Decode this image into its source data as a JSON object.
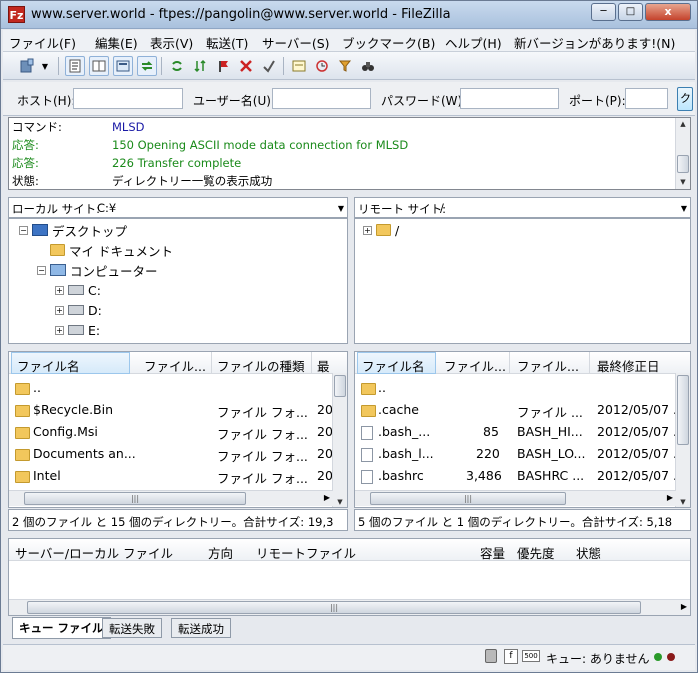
{
  "window": {
    "title": "www.server.world - ftpes://pangolin@www.server.world - FileZilla",
    "app_icon": "Fz",
    "minimize": "─",
    "maximize": "□",
    "close": "x"
  },
  "menu": [
    "ファイル(F)",
    "編集(E)",
    "表示(V)",
    "転送(T)",
    "サーバー(S)",
    "ブックマーク(B)",
    "ヘルプ(H)",
    "新バージョンがあります!(N)"
  ],
  "toolbar_icons": [
    "site-manager-icon",
    "dropdown-icon",
    "message-log-icon",
    "local-tree-icon",
    "remote-tree-icon",
    "transfer-queue-icon",
    "refresh-icon",
    "process-queue-icon",
    "cancel-icon",
    "disconnect-icon",
    "reconnect-icon",
    "directory-compare-icon",
    "sync-browsing-icon",
    "filter-icon",
    "find-icon",
    "binoculars-icon"
  ],
  "quickconnect": {
    "host_label": "ホスト(H):",
    "user_label": "ユーザー名(U):",
    "pass_label": "パスワード(W):",
    "port_label": "ポート(P):",
    "button": "ク"
  },
  "log": [
    {
      "key": "コマンド:",
      "text": "MLSD",
      "color": "#1a1aa6"
    },
    {
      "key": "応答:",
      "text": "150 Opening ASCII mode data connection for MLSD",
      "color": "#1a8a1a"
    },
    {
      "key": "応答:",
      "text": "226 Transfer complete",
      "color": "#1a8a1a"
    },
    {
      "key": "状態:",
      "text": "ディレクトリー一覧の表示成功",
      "color": "#000000"
    }
  ],
  "local": {
    "site_label": "ローカル サイト:",
    "site_path": "C:¥",
    "tree": [
      "デスクトップ",
      "マイ ドキュメント",
      "コンピューター",
      "C:",
      "D:",
      "E:"
    ],
    "columns": [
      "ファイル名",
      "ファイル...",
      "ファイルの種類",
      "最"
    ],
    "rows": [
      {
        "name": "..",
        "size": "",
        "type": "",
        "date": ""
      },
      {
        "name": "$Recycle.Bin",
        "size": "",
        "type": "ファイル フォ...",
        "date": "20"
      },
      {
        "name": "Config.Msi",
        "size": "",
        "type": "ファイル フォ...",
        "date": "20"
      },
      {
        "name": "Documents an...",
        "size": "",
        "type": "ファイル フォ...",
        "date": "20"
      },
      {
        "name": "Intel",
        "size": "",
        "type": "ファイル フォ...",
        "date": "20"
      }
    ],
    "status": "2 個のファイル と 15 個のディレクトリー。合計サイズ: 19,3"
  },
  "remote": {
    "site_label": "リモート サイト:",
    "site_path": "/",
    "tree": [
      "/"
    ],
    "columns": [
      "ファイル名",
      "ファイル...",
      "ファイル...",
      "最終修正日"
    ],
    "rows": [
      {
        "name": "..",
        "size": "",
        "type": "",
        "date": "",
        "kind": "folder"
      },
      {
        "name": ".cache",
        "size": "",
        "type": "ファイル ...",
        "date": "2012/05/07 .",
        "kind": "folder"
      },
      {
        "name": ".bash_...",
        "size": "85",
        "type": "BASH_HI...",
        "date": "2012/05/07 .",
        "kind": "file"
      },
      {
        "name": ".bash_l...",
        "size": "220",
        "type": "BASH_LO...",
        "date": "2012/05/07 .",
        "kind": "file"
      },
      {
        "name": ".bashrc",
        "size": "3,486",
        "type": "BASHRC ...",
        "date": "2012/05/07 .",
        "kind": "file"
      }
    ],
    "status": "5 個のファイル と 1 個のディレクトリー。合計サイズ: 5,18"
  },
  "queue": {
    "columns": [
      "サーバー/ローカル ファイル",
      "方向",
      "リモートファイル",
      "容量",
      "優先度",
      "状態"
    ]
  },
  "tabs": [
    "キュー ファイル",
    "転送失敗",
    "転送成功"
  ],
  "statusbar": {
    "queue_text": "キュー: ありません"
  },
  "colors": {
    "titlebar": "#b9cfe8",
    "log_command": "#1a1aa6",
    "log_response": "#1a8a1a",
    "selection": "#d6eafa"
  }
}
